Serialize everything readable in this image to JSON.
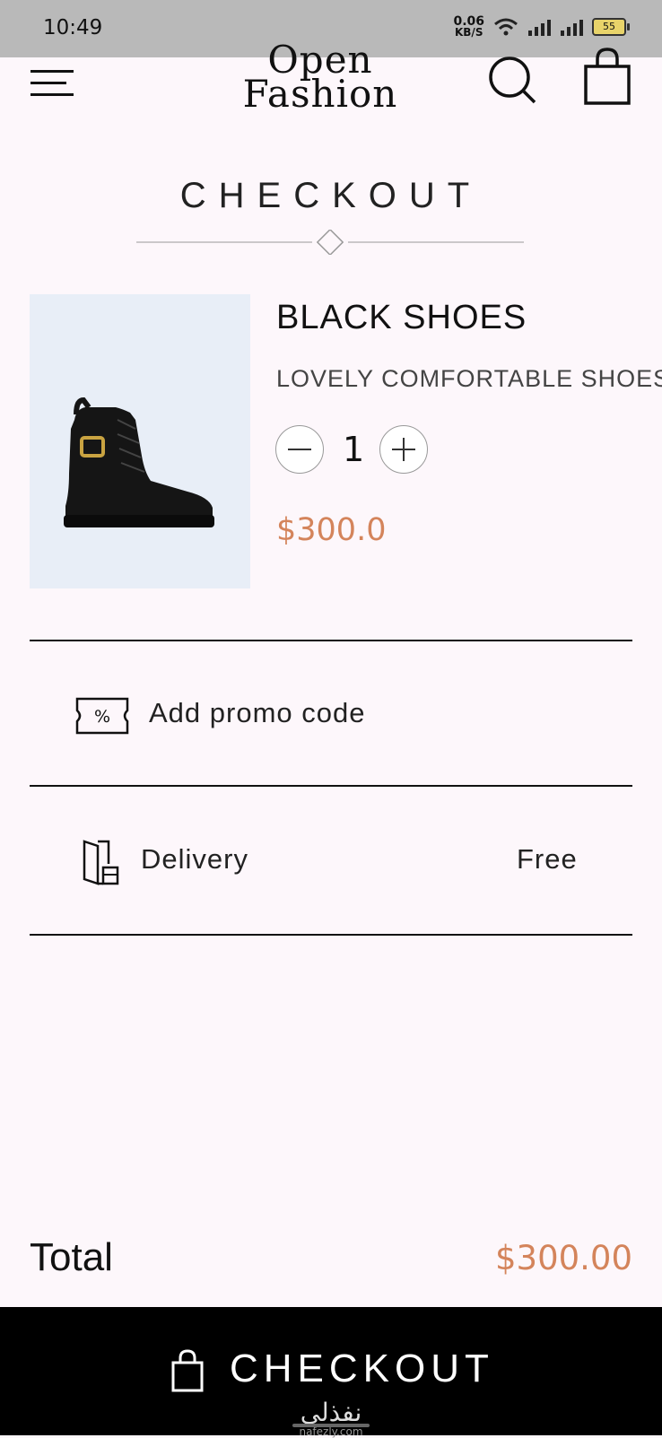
{
  "status_bar": {
    "time": "10:49",
    "network_speed": "0.06",
    "network_unit": "KB/S",
    "battery": "55"
  },
  "app_bar": {
    "logo_line1": "Open",
    "logo_line2": "Fashion",
    "menu_icon": "menu-icon",
    "search_icon": "search-icon",
    "bag_icon": "shopping-bag-icon"
  },
  "page": {
    "title": "CHECKOUT"
  },
  "cart": {
    "items": [
      {
        "name": "BLACK SHOES",
        "description": "LOVELY COMFORTABLE SHOES",
        "quantity": "1",
        "price": "$300.0"
      }
    ]
  },
  "promo": {
    "label": "Add promo code",
    "icon": "promo-ticket-icon"
  },
  "delivery": {
    "label": "Delivery",
    "value": "Free",
    "icon": "delivery-door-icon"
  },
  "summary": {
    "total_label": "Total",
    "total_value": "$300.00"
  },
  "checkout_button": {
    "label": "CHECKOUT",
    "icon": "shopping-bag-icon"
  },
  "watermark": {
    "text": "نفذلي",
    "domain": "nafezly.com"
  },
  "colors": {
    "accent": "#d4845b",
    "background": "#fdf7fb",
    "button_bg": "#000000"
  }
}
